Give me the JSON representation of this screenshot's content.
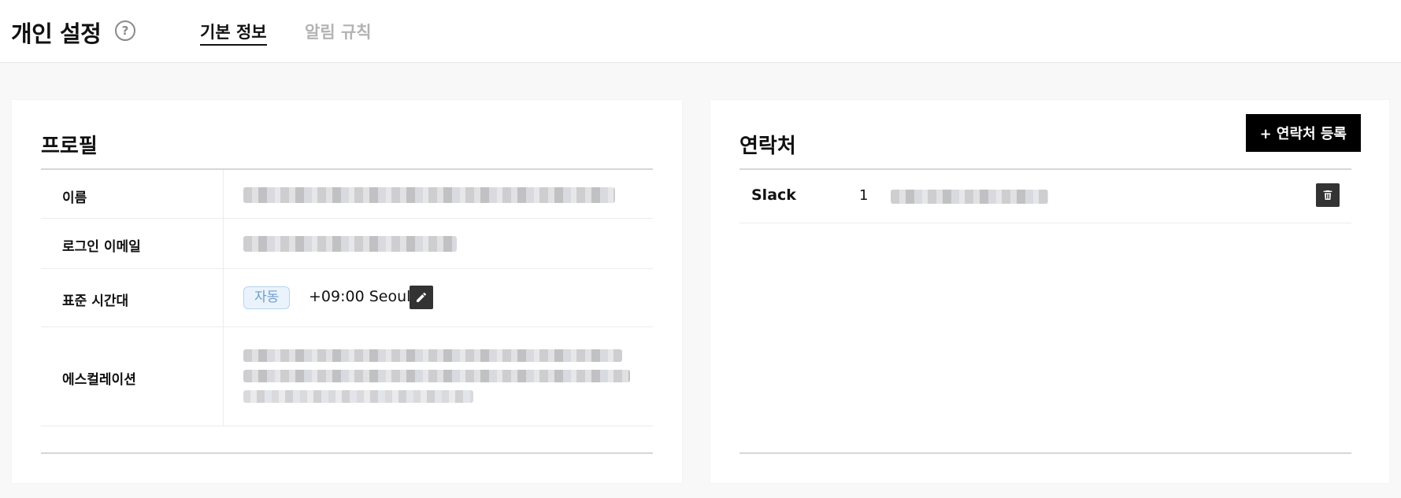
{
  "header": {
    "title": "개인 설정",
    "help_icon": "?",
    "tabs": [
      {
        "label": "기본 정보",
        "active": true
      },
      {
        "label": "알림 규칙",
        "active": false
      }
    ]
  },
  "profile": {
    "title": "프로필",
    "rows": {
      "name": {
        "label": "이름"
      },
      "email": {
        "label": "로그인 이메일"
      },
      "timezone": {
        "label": "표준 시간대",
        "badge": "자동",
        "value": "+09:00 Seoul"
      },
      "escalation": {
        "label": "에스컬레이션"
      }
    }
  },
  "contacts": {
    "title": "연락처",
    "add_button": "+ 연락처 등록",
    "items": [
      {
        "type": "Slack",
        "index": "1"
      }
    ]
  },
  "colors": {
    "accent_black": "#000000",
    "badge_bg": "#eaf3fc",
    "badge_text": "#6f9dcb",
    "inactive_tab": "#b3b3b3"
  },
  "icons": {
    "help": "question-circle-icon",
    "edit": "pencil-icon",
    "delete": "trash-icon"
  }
}
